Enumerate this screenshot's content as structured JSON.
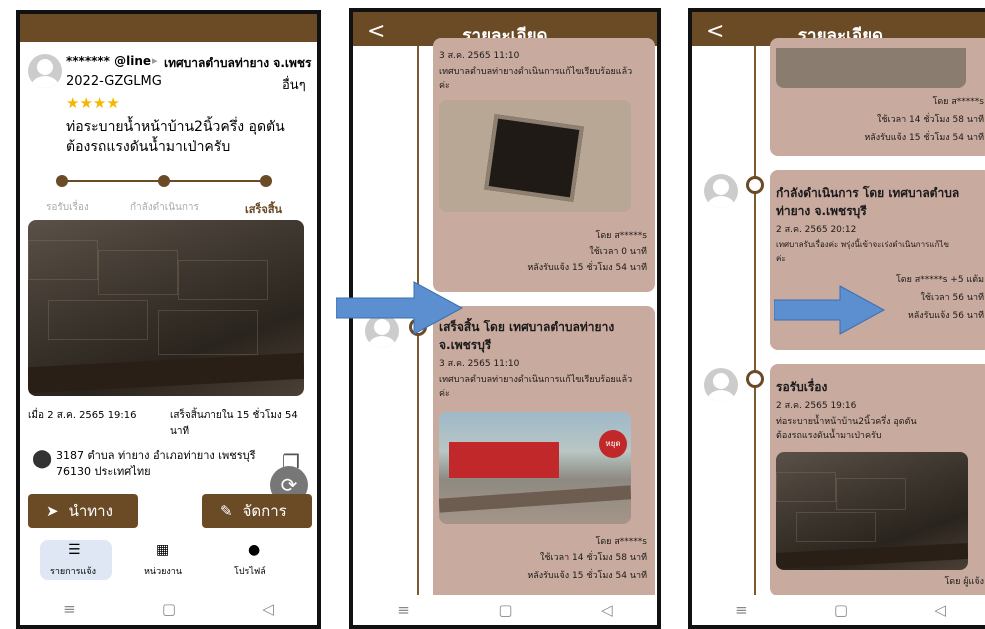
{
  "panel1": {
    "reporter": "******* @line",
    "agency": "เทศบาลตำบลท่ายาง จ.เพชร",
    "ticket_id": "2022-GZGLMG",
    "category": "อื่นๆ",
    "stars": "★★★★",
    "description_line1": "ท่อระบายน้ำหน้าบ้าน2นิ้วครึ่ง อุดตัน",
    "description_line2": "ต้องรถแรงดันน้ำมาเป่าครับ",
    "steps": [
      "รอรับเรื่อง",
      "กำลังดำเนินการ",
      "เสร็จสิ้น"
    ],
    "reported_at": "เมื่อ 2 ส.ค. 2565 19:16",
    "finished_line1": "เสร็จสิ้นภายใน 15 ชั่วโมง 54",
    "finished_line2": "นาที",
    "address_line1": "3187 ตำบล ท่ายาง อำเภอท่ายาง เพชรบุรี",
    "address_line2": "76130 ประเทศไทย",
    "navigate_label": "นำทาง",
    "manage_label": "จัดการ",
    "tabs": [
      "รายการแจ้ง",
      "หน่วยงาน",
      "โปรไฟล์"
    ]
  },
  "panel2": {
    "title": "รายละเอียด",
    "top_partial_date": "3 ส.ค. 2565 11:10",
    "top_text": "เทศบาลตำบลท่ายางดำเนินการแก้ไขเรียบร้อยแล้ว",
    "top_text2": "ค่ะ",
    "top_by": "โดย ส*****s",
    "top_time_used": "ใช้เวลา 0 นาที",
    "top_after": "หลังรับแจ้ง 15 ชั่วโมง 54 นาที",
    "card_title_line1": "เสร็จสิ้น โดย  เทศบาลตำบลท่ายาง",
    "card_title_line2": "จ.เพชรบุรี",
    "card_date": "3 ส.ค. 2565 11:10",
    "card_text": "เทศบาลตำบลท่ายางดำเนินการแก้ไขเรียบร้อยแล้ว",
    "card_text2": "ค่ะ",
    "card_by": "โดย ส*****s",
    "card_time_used": "ใช้เวลา 14 ชั่วโมง 58 นาที",
    "card_after": "หลังรับแจ้ง 15 ชั่วโมง 54 นาที",
    "stop_sign": "หยุด"
  },
  "panel3": {
    "title": "รายละเอียด",
    "top_by": "โดย ส*****s",
    "top_time_used": "ใช้เวลา 14 ชั่วโมง 58 นาที",
    "top_after": "หลังรับแจ้ง 15 ชั่วโมง 54 นาที",
    "mid_title_line1": "กำลังดำเนินการ โดย  เทศบาลตำบล",
    "mid_title_line2": "ท่ายาง จ.เพชรบุรี",
    "mid_date": "2 ส.ค. 2565 20:12",
    "mid_text": "เทศบาลรับเรื่องค่ะ พรุ่งนี้เข้าจะเร่งดำเนินการแก้ไข",
    "mid_text2": "ค่ะ",
    "mid_by": "โดย ส*****s +5 แต้ม",
    "mid_time_used": "ใช้เวลา 56 นาที",
    "mid_after": "หลังรับแจ้ง 56 นาที",
    "bot_title": "รอรับเรื่อง",
    "bot_date": "2 ส.ค. 2565 19:16",
    "bot_text": "ท่อระบายน้ำหน้าบ้าน2นิ้วครึ่ง อุดตัน",
    "bot_text2": "ต้องรถแรงดันน้ำมาเป่าครับ",
    "bot_by": "โดย ผู้แจ้ง"
  },
  "colors": {
    "brown": "#6b4a26",
    "card": "#c9aa9e",
    "arrow": "#5b8fd0"
  }
}
